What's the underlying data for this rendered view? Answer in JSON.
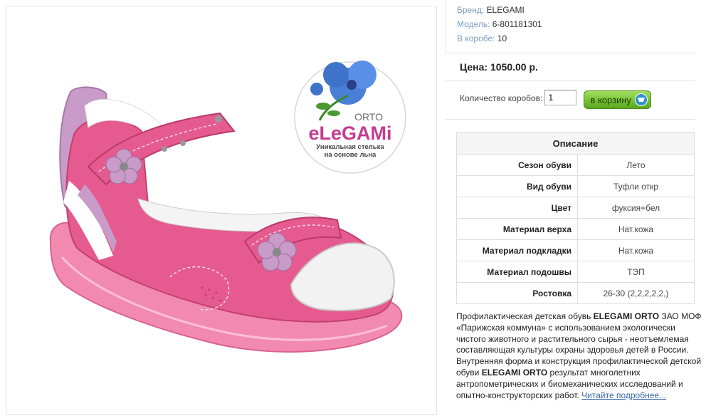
{
  "product": {
    "brand_label": "Бренд:",
    "brand": "ELEGAMI",
    "model_label": "Модель:",
    "model": "6-801181301",
    "box_label": "В коробе:",
    "box_count": "10",
    "price": "Цена: 1050.00 р."
  },
  "logo": {
    "orto": "ORTO",
    "brand": "eLeGAMi",
    "tagline_1": "Уникальная стелька",
    "tagline_2": "на основе льна"
  },
  "order": {
    "qty_label": "Количество коробов:",
    "qty_value": "1",
    "cart_label": "в корзину"
  },
  "description": {
    "header": "Описание",
    "rows": [
      {
        "key": "Сезон обуви",
        "value": "Лето"
      },
      {
        "key": "Вид обуви",
        "value": "Туфли откр"
      },
      {
        "key": "Цвет",
        "value": "фуксия+бел"
      },
      {
        "key": "Материал верха",
        "value": "Нат.кожа"
      },
      {
        "key": "Материал подкладки",
        "value": "Нат.кожа"
      },
      {
        "key": "Материал подошвы",
        "value": "ТЭП"
      },
      {
        "key": "Ростовка",
        "value": "26-30 (2,2,2,2,2,)"
      }
    ],
    "text_1": "Профилактическая детская обувь ",
    "brand_bold_1": "ELEGAMI ORTO",
    "text_2": " ЗАО МОФ «Парижская коммуна» с использованием экологически чистого животного и растительного сырья - неотъемлемая составляющая культуры охраны здоровья детей в России. Внутренняя форма и конструкция профилактической детской обуви ",
    "brand_bold_2": "ELEGAMI ORTO",
    "text_3": " результат многолетних антропометрических и биомеханических исследований и опытно-конструкторских работ. ",
    "read_more": "Читайте подробнее..."
  },
  "colors": {
    "meta_key": "#7a9bc0",
    "accent_green": "#58a81e",
    "link": "#3a6aa5",
    "shoe_pink": "#e55b8f",
    "sole_pink": "#f07fa6",
    "lilac": "#c99bc9"
  }
}
